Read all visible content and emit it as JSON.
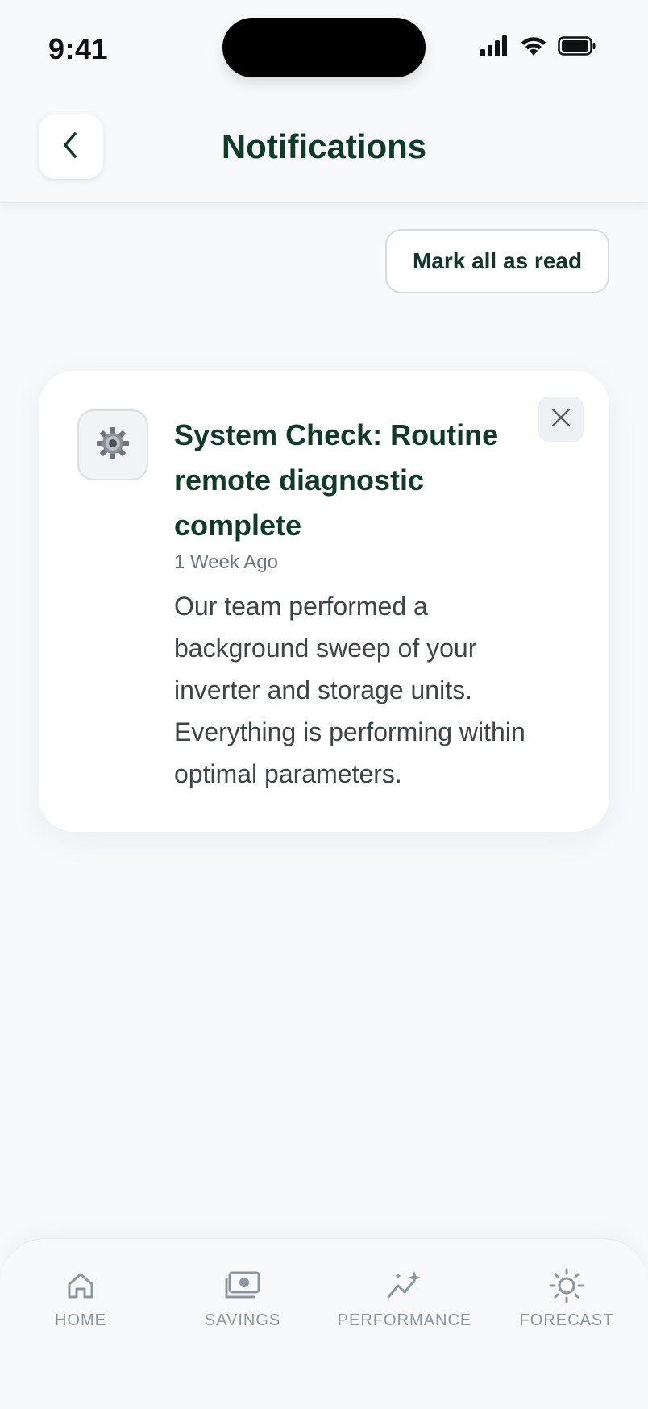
{
  "status_bar": {
    "time": "9:41",
    "icons": [
      "signal-icon",
      "wifi-icon",
      "battery-icon"
    ]
  },
  "header": {
    "title": "Notifications",
    "back_icon": "chevron-left-icon"
  },
  "actions": {
    "mark_all_label": "Mark all as read"
  },
  "notification": {
    "icon": "gear-icon",
    "title": "System Check: Routine remote diagnostic complete",
    "time": "1 Week Ago",
    "body": "Our team performed a background sweep of your inverter and storage units. Everything is performing within optimal parameters.",
    "dismiss_icon": "close-icon"
  },
  "bottom_nav": {
    "items": [
      {
        "label": "HOME",
        "icon": "home-icon"
      },
      {
        "label": "SAVINGS",
        "icon": "cash-icon"
      },
      {
        "label": "PERFORMANCE",
        "icon": "sparkle-chart-icon"
      },
      {
        "label": "FORECAST",
        "icon": "sun-icon"
      }
    ]
  },
  "colors": {
    "primary_text": "#0f3a28",
    "background": "#f7f9fb",
    "muted": "#8c969b"
  }
}
